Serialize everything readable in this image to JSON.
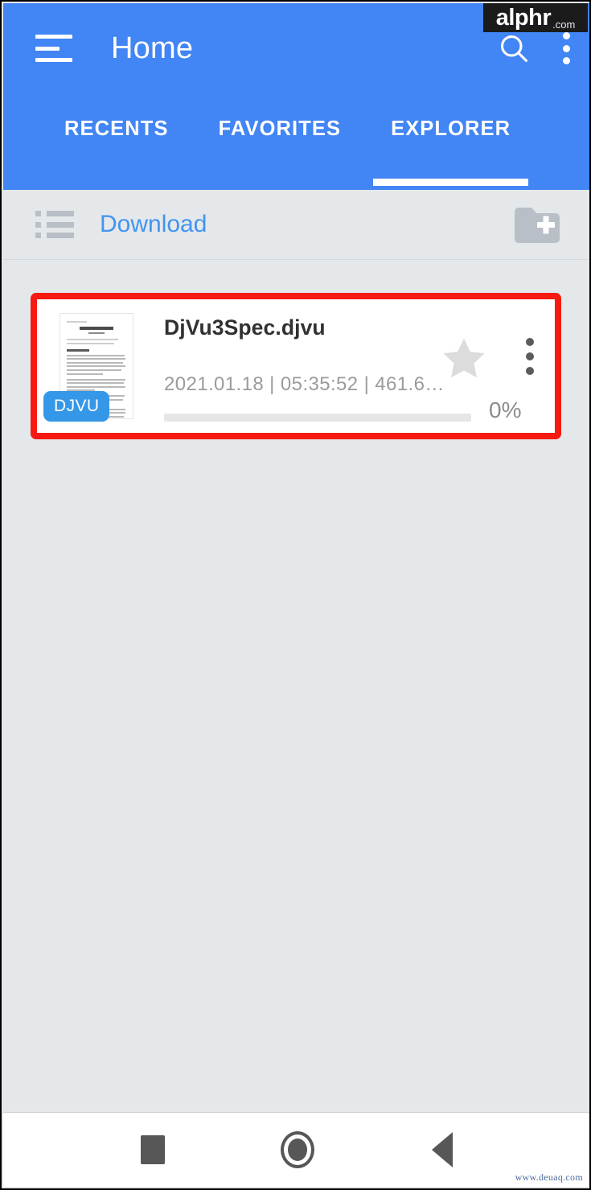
{
  "branding": {
    "logo_main": "alphr",
    "logo_suffix": ".com",
    "watermark": "www.deuaq.com"
  },
  "colors": {
    "appbar_blue": "#4285F4",
    "body_background": "#E4E8EB",
    "crumb_link": "#4294EE",
    "highlight_red": "#F61A12",
    "badge_blue": "#3497E8",
    "card_white": "#FFFFFF"
  },
  "appbar": {
    "menu_icon": "hamburger-menu-icon",
    "title": "Home",
    "search_icon": "search-icon",
    "overflow_icon": "overflow-menu-icon",
    "tabs": [
      {
        "label": "RECENTS",
        "active": false
      },
      {
        "label": "FAVORITES",
        "active": false
      },
      {
        "label": "EXPLORER",
        "active": true
      }
    ]
  },
  "breadcrumb": {
    "view_toggle_icon": "list-view-icon",
    "path": "Download",
    "new_folder_icon": "new-folder-icon"
  },
  "file_card": {
    "thumbnail_icon": "document-thumbnail",
    "format_badge": "DJVU",
    "name": "DjVu3Spec.djvu",
    "meta": "2021.01.18 | 05:35:52 | 461.6…",
    "meta_parts": {
      "date": "2021.01.18",
      "time": "05:35:52",
      "size": "461.6…"
    },
    "progress_percent": 0,
    "progress_label": "0%",
    "favorite_icon": "star-icon",
    "favorited": false,
    "overflow_icon": "overflow-menu-icon",
    "highlighted": true
  },
  "navbar": {
    "recents_icon": "recents-square-icon",
    "home_icon": "home-circle-icon",
    "back_icon": "back-triangle-icon"
  }
}
